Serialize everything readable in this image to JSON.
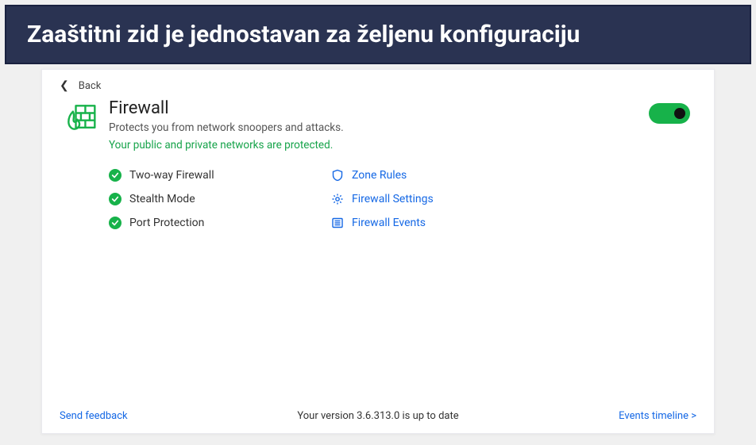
{
  "caption": "Zaaštitni zid je jednostavan za željenu konfiguraciju",
  "back": {
    "label": "Back"
  },
  "header": {
    "title": "Firewall",
    "subtitle": "Protects you from network snoopers and attacks.",
    "status": "Your public and private networks are protected.",
    "toggle_on": true
  },
  "features": [
    {
      "label": "Two-way Firewall"
    },
    {
      "label": "Stealth Mode"
    },
    {
      "label": "Port Protection"
    }
  ],
  "links": [
    {
      "icon": "shield-icon",
      "label": "Zone Rules"
    },
    {
      "icon": "gear-icon",
      "label": "Firewall Settings"
    },
    {
      "icon": "list-icon",
      "label": "Firewall Events"
    }
  ],
  "footer": {
    "feedback": "Send feedback",
    "version": "Your version 3.6.313.0 is up to date",
    "timeline": "Events timeline  >"
  }
}
